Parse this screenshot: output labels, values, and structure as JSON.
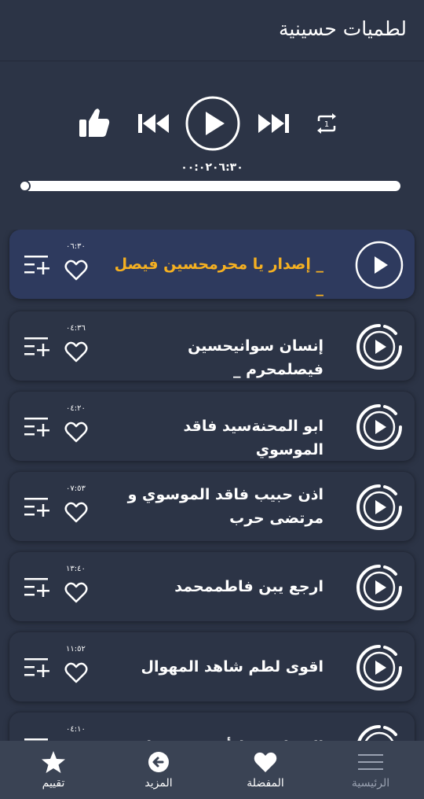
{
  "header": {
    "title": "لطميات حسينية"
  },
  "player": {
    "time_readout": "٠٠:٠٢٠٦:٣٠",
    "progress_fraction": 0.0,
    "icons": [
      "thumbs-up-icon",
      "skip-previous-icon",
      "play-icon",
      "skip-next-icon",
      "repeat-one-icon"
    ]
  },
  "tracks": [
    {
      "title": "_ إصدار يا محرمحسين فيصل _",
      "duration": "٠٦:٣٠",
      "active": true
    },
    {
      "title": "إنسان سوانيحسين فيصلمحرم _",
      "duration": "٠٤:٣٦",
      "active": false
    },
    {
      "title": "ابو المحنةسيد فاقد الموسوي",
      "duration": "٠٤:٢٠",
      "active": false
    },
    {
      "title": "اذن حبيب   فاقد الموسوي و مرتضى حرب",
      "duration": "٠٧:٥٣",
      "active": false
    },
    {
      "title": "ارجع يبن فاطممحمد",
      "duration": "١٣:٤٠",
      "active": false
    },
    {
      "title": "اقوى لطم شاهد المهوال",
      "duration": "١١:٥٢",
      "active": false
    },
    {
      "title": "الشعائر خط أحمرسيد فاقد",
      "duration": "٠٤:١٠",
      "active": false
    }
  ],
  "bottom_nav": {
    "rate": "تقييم",
    "more": "المزيد",
    "favorites": "المفضلة",
    "home": "الرئيسية"
  },
  "colors": {
    "background": "#2c3446",
    "active_card": "#2e3a5e",
    "active_title": "#f5b021",
    "nav_bar": "#3a4354"
  }
}
